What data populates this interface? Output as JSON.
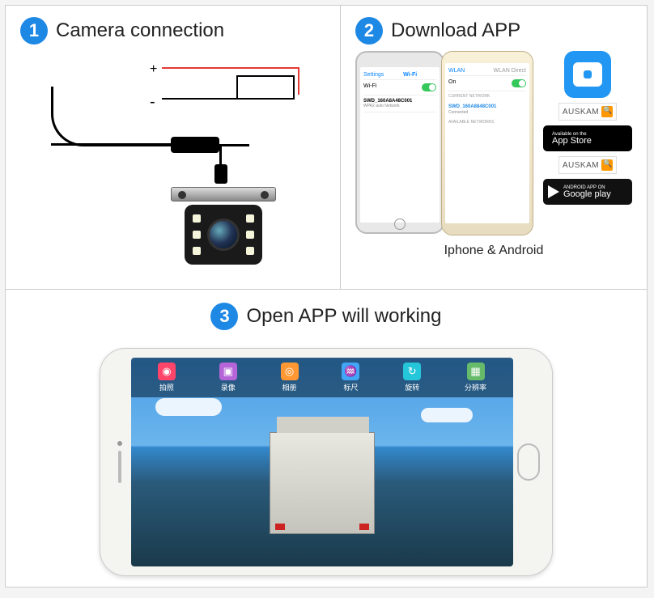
{
  "step1": {
    "number": "1",
    "title": "Camera connection",
    "plus": "+",
    "minus": "-"
  },
  "step2": {
    "number": "2",
    "title": "Download APP",
    "caption": "Iphone & Android",
    "phone_iphone": {
      "back": "Settings",
      "title": "Wi-Fi",
      "wifi_label": "Wi-Fi",
      "network": "SWD_160A8A48C001",
      "network_sub": "WPA2 auto Network"
    },
    "phone_android": {
      "title": "WLAN",
      "tab": "WLAN Direct",
      "on": "On",
      "section": "CURRENT NETWORK",
      "network": "SWD_160A8848C001",
      "sub": "Connected",
      "avail": "AVAILABLE NETWORKS"
    },
    "auskam": "AUSKAM",
    "appstore_small": "Available on the",
    "appstore_big": "App Store",
    "gplay_small": "ANDROID APP ON",
    "gplay_big": "Google play"
  },
  "step3": {
    "number": "3",
    "title": "Open APP will working",
    "toolbar": [
      "拍照",
      "录像",
      "相册",
      "标尺",
      "旋转",
      "分辨率"
    ]
  }
}
